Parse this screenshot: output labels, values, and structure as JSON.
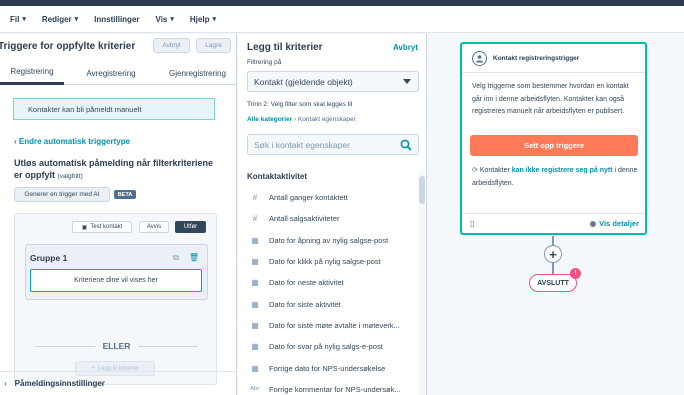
{
  "menu": [
    {
      "label": "Fil"
    },
    {
      "label": "Rediger"
    },
    {
      "label": "Innstillinger"
    },
    {
      "label": "Vis"
    },
    {
      "label": "Hjelp"
    }
  ],
  "left_panel": {
    "title": "Triggere for oppfylte kriterier",
    "cancel_label": "Avbryt",
    "save_label": "Lagre",
    "tabs": [
      "Registrering",
      "Avregistrering",
      "Gjenregistrering"
    ],
    "info": "Kontakter kan bli påmeldt manuelt",
    "back_link": "Endre automatisk triggertype",
    "section_title": "Utløs automatisk påmelding når filterkriteriene er oppfylt",
    "section_optional": "(valgfritt)",
    "generate_label": "Generer en trigger med AI",
    "beta_label": "BETA",
    "test_contact_label": "Test kontakt",
    "discard_label": "Avvis",
    "apply_label": "Utfør",
    "group_label": "Gruppe 1",
    "criteria_placeholder": "Kriteriene dine vil vises her",
    "or_label": "ELLER",
    "add_criteria_label": "Legg til kriterier",
    "enroll_settings_label": "Påmeldingsinnstillinger"
  },
  "middle_panel": {
    "title": "Legg til kriterier",
    "cancel_label": "Avbryt",
    "filter_label": "Filtrering på",
    "filter_value": "Kontakt (gjeldende objekt)",
    "step_label": "Trinn 2: Velg filter som skal legges til",
    "breadcrumb_all": "Alle kategorier",
    "breadcrumb_sep": "›",
    "breadcrumb_current": "Kontakt egenskaper",
    "search_placeholder": "Søk i kontakt egenskaper",
    "category_heading": "Kontaktaktivitet",
    "properties": [
      {
        "icon": "#",
        "label": "Antall ganger kontaktett"
      },
      {
        "icon": "#",
        "label": "Antall salgsaktiviteter"
      },
      {
        "icon": "cal",
        "label": "Dato for åpning av nylig salgse-post"
      },
      {
        "icon": "cal",
        "label": "Dato for klikk på nylig salgse-post"
      },
      {
        "icon": "cal",
        "label": "Dato for neste aktivitet"
      },
      {
        "icon": "cal",
        "label": "Dato for siste aktivitet"
      },
      {
        "icon": "cal",
        "label": "Dato for siste møte avtalte i møteverk..."
      },
      {
        "icon": "cal",
        "label": "Dato for svar på nylig salgs-e-post"
      },
      {
        "icon": "cal",
        "label": "Forrige dato for NPS-undersøkelse"
      },
      {
        "icon": "Abc",
        "label": "Forrige kommentar for NPS-undersøk..."
      }
    ]
  },
  "trigger_card": {
    "title": "Kontakt registreringstrigger",
    "description": "Velg triggerne som bestemmer hvordan en kontakt går inn i denne arbeidsflyten. Kontakter kan også registreres manuelt når arbeidsflyten er publisert.",
    "setup_button": "Sett opp triggere",
    "note_prefix": "Kontakter",
    "note_strong": "kan ikke registrere seg på nytt",
    "note_suffix": "i denne arbeidsflyten.",
    "details_label": "Vis detaljer"
  },
  "canvas": {
    "end_label": "AVSLUTT",
    "end_badge": "!"
  },
  "colors": {
    "accent": "#0091ae",
    "primary_button": "#ff7a59",
    "trigger_border": "#00bda5",
    "end_color": "#f2547d"
  }
}
